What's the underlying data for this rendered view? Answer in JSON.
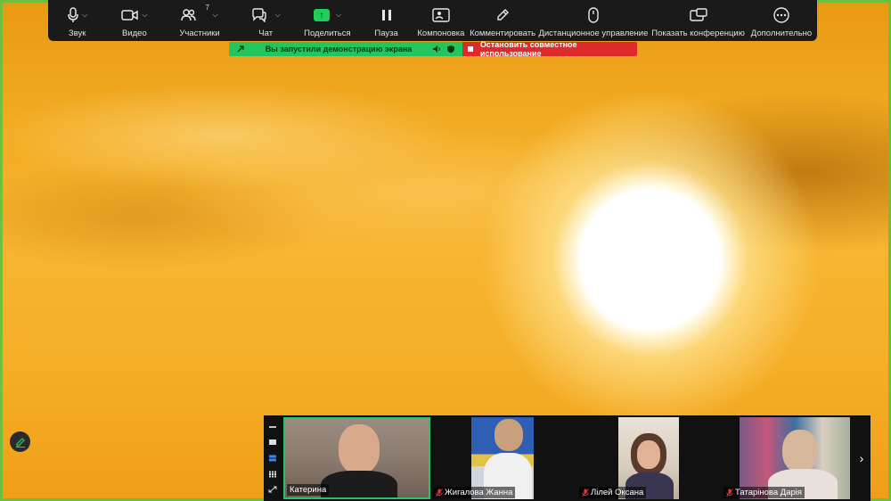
{
  "toolbar": {
    "items": [
      {
        "label": "Звук"
      },
      {
        "label": "Видео"
      },
      {
        "label": "Участники",
        "count": "7"
      },
      {
        "label": "Чат"
      },
      {
        "label": "Поделиться"
      },
      {
        "label": "Пауза"
      },
      {
        "label": "Компоновка"
      },
      {
        "label": "Комментировать"
      },
      {
        "label": "Дистанционное управление"
      },
      {
        "label": "Показать конференцию"
      },
      {
        "label": "Дополнительно"
      }
    ]
  },
  "share_status": {
    "message": "Вы запустили демонстрацию экрана",
    "stop_label": "Остановить совместное использование"
  },
  "participants": [
    {
      "name": "Катерина",
      "muted": false
    },
    {
      "name": "Жигалова Жанна",
      "muted": true
    },
    {
      "name": "Лілей Оксана",
      "muted": true
    },
    {
      "name": "Татарінова Дарія",
      "muted": true
    }
  ],
  "colors": {
    "share_green": "#22c55e",
    "stop_red": "#dd2b2b",
    "toolbar_bg": "#1a1a1a",
    "active_border": "#27c26b"
  }
}
